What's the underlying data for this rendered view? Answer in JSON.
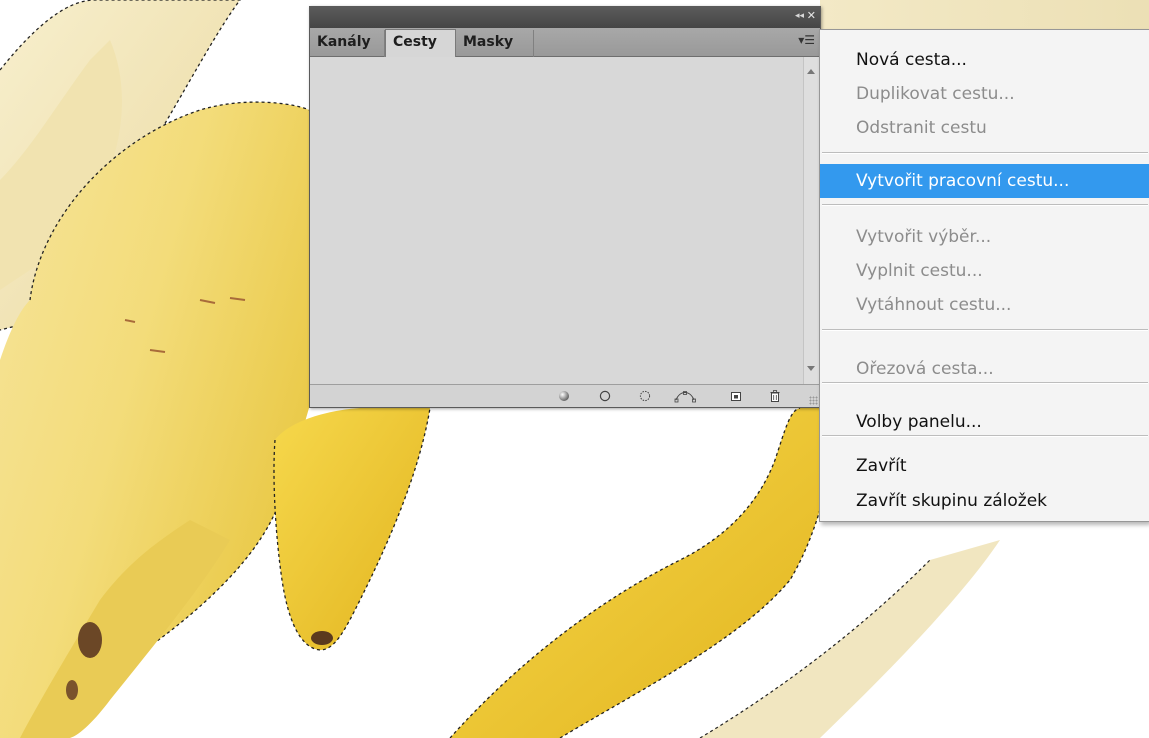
{
  "panel": {
    "tabs": [
      {
        "label": "Kanály",
        "active": false
      },
      {
        "label": "Cesty",
        "active": true
      },
      {
        "label": "Masky",
        "active": false
      }
    ],
    "icons": {
      "collapse": "double-chevron-left-icon",
      "close": "close-icon",
      "panel_menu": "panel-menu-icon"
    },
    "footer_buttons": [
      "fill-path-icon",
      "stroke-path-icon",
      "load-selection-icon",
      "make-work-path-icon",
      "new-path-icon",
      "delete-path-icon"
    ]
  },
  "menu": {
    "items": [
      {
        "label": "Nová cesta...",
        "enabled": true
      },
      {
        "label": "Duplikovat cestu...",
        "enabled": false
      },
      {
        "label": "Odstranit cestu",
        "enabled": false
      },
      {
        "label": "Vytvořit pracovní cestu...",
        "enabled": true,
        "highlighted": true
      },
      {
        "label": "Vytvořit výběr...",
        "enabled": false
      },
      {
        "label": "Vyplnit cestu...",
        "enabled": false
      },
      {
        "label": "Vytáhnout cestu...",
        "enabled": false
      },
      {
        "label": "Ořezová cesta...",
        "enabled": false
      },
      {
        "label": "Volby panelu...",
        "enabled": true
      },
      {
        "label": "Zavřít",
        "enabled": true
      },
      {
        "label": "Zavřít skupinu záložek",
        "enabled": true
      }
    ]
  },
  "colors": {
    "menu_highlight": "#3399ee",
    "banana_yellow": "#f3d44a",
    "banana_pale": "#f6ecc2",
    "panel_bg": "#d6d6d6"
  }
}
